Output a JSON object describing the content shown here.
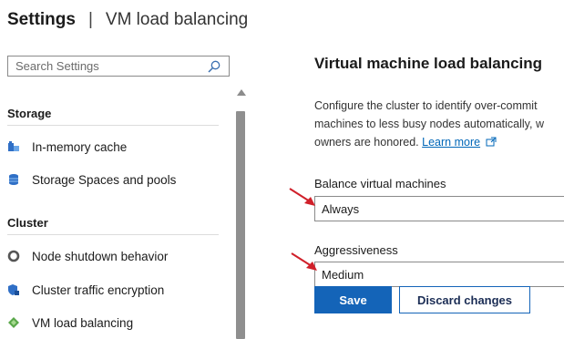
{
  "header": {
    "title": "Settings",
    "separator": "|",
    "subtitle": "VM load balancing"
  },
  "sidebar": {
    "search_placeholder": "Search Settings",
    "sections": [
      {
        "label": "Storage",
        "items": [
          {
            "label": "In-memory cache",
            "icon": "memory-cache-icon"
          },
          {
            "label": "Storage Spaces and pools",
            "icon": "storage-pools-icon"
          }
        ]
      },
      {
        "label": "Cluster",
        "items": [
          {
            "label": "Node shutdown behavior",
            "icon": "node-shutdown-icon"
          },
          {
            "label": "Cluster traffic encryption",
            "icon": "encryption-shield-icon"
          },
          {
            "label": "VM load balancing",
            "icon": "load-balancing-icon"
          }
        ]
      }
    ]
  },
  "main": {
    "title": "Virtual machine load balancing",
    "description_lines": [
      "Configure the cluster to identify over-commit",
      "machines to less busy nodes automatically, w",
      "owners are honored."
    ],
    "learn_more": "Learn more",
    "balance_label": "Balance virtual machines",
    "balance_value": "Always",
    "aggressiveness_label": "Aggressiveness",
    "aggressiveness_value": "Medium",
    "save_label": "Save",
    "discard_label": "Discard changes"
  },
  "colors": {
    "accent": "#1464b8",
    "link": "#0067b8",
    "arrow": "#d0202a"
  }
}
